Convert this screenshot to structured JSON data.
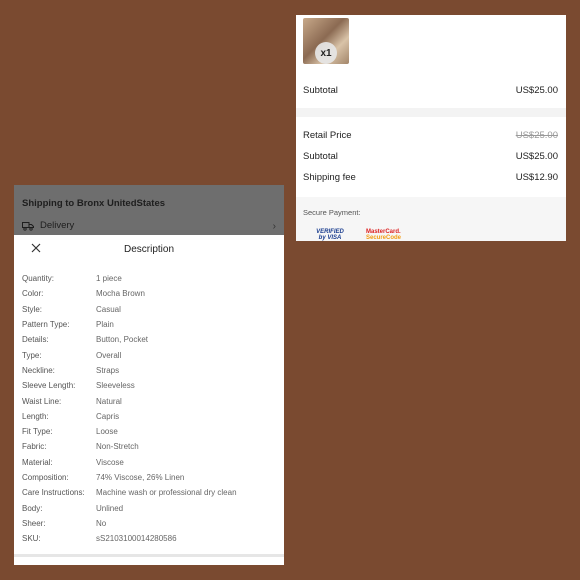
{
  "cart": {
    "quantity_badge": "x1",
    "subtotal_label": "Subtotal",
    "subtotal_value": "US$25.00",
    "retail_price_label": "Retail Price",
    "retail_price_value": "US$25.00",
    "subtotal2_label": "Subtotal",
    "subtotal2_value": "US$25.00",
    "shipping_fee_label": "Shipping fee",
    "shipping_fee_value": "US$12.90",
    "secure_payment_label": "Secure Payment:",
    "payment_logos": [
      {
        "icon": "verified-by-visa-logo",
        "text_top": "VERIFIED",
        "text_bottom": "by VISA"
      },
      {
        "icon": "mastercard-securecode-logo",
        "text_top": "MasterCard.",
        "text_bottom": "SecureCode"
      }
    ]
  },
  "shipping": {
    "title": "Shipping to Bronx UnitedStates",
    "delivery_label": "Delivery",
    "delivery_icon": "truck-icon"
  },
  "description": {
    "title": "Description",
    "close_icon": "close-icon",
    "specs": [
      {
        "key": "Quantity:",
        "value": "1 piece"
      },
      {
        "key": "Color:",
        "value": "Mocha Brown"
      },
      {
        "key": "Style:",
        "value": "Casual"
      },
      {
        "key": "Pattern Type:",
        "value": "Plain"
      },
      {
        "key": "Details:",
        "value": "Button, Pocket"
      },
      {
        "key": "Type:",
        "value": "Overall"
      },
      {
        "key": "Neckline:",
        "value": "Straps"
      },
      {
        "key": "Sleeve Length:",
        "value": "Sleeveless"
      },
      {
        "key": "Waist Line:",
        "value": "Natural"
      },
      {
        "key": "Length:",
        "value": "Capris"
      },
      {
        "key": "Fit Type:",
        "value": "Loose"
      },
      {
        "key": "Fabric:",
        "value": "Non-Stretch"
      },
      {
        "key": "Material:",
        "value": "Viscose"
      },
      {
        "key": "Composition:",
        "value": "74% Viscose, 26% Linen"
      },
      {
        "key": "Care Instructions:",
        "value": "Machine wash or professional dry clean"
      },
      {
        "key": "Body:",
        "value": "Unlined"
      },
      {
        "key": "Sheer:",
        "value": "No"
      },
      {
        "key": "SKU:",
        "value": "sS2103100014280586"
      }
    ]
  }
}
